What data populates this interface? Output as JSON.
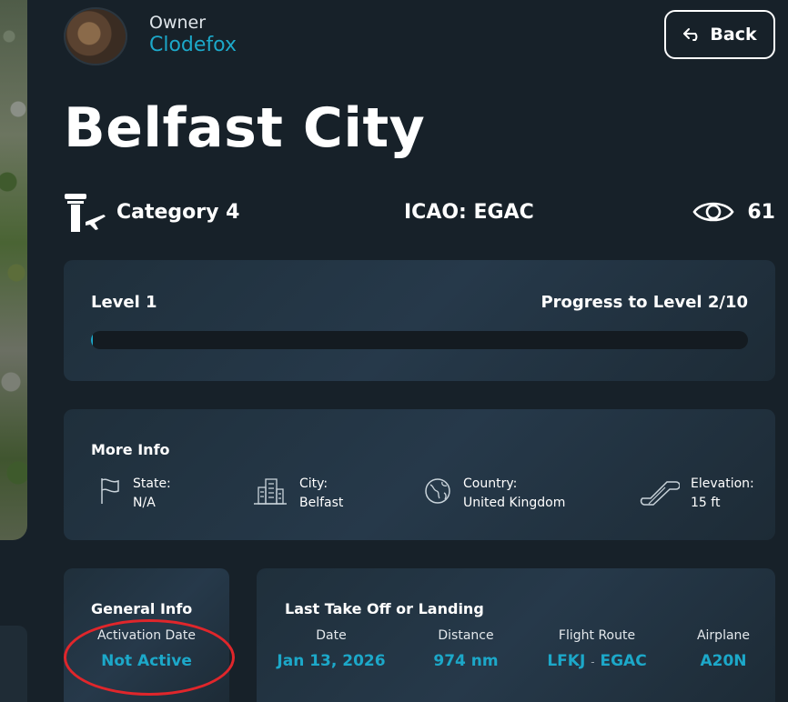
{
  "owner": {
    "label": "Owner",
    "name": "Clodefox"
  },
  "back_button": {
    "label": "Back",
    "icon": "back-arrow-icon"
  },
  "airport": {
    "name": "Belfast City",
    "category": "Category 4",
    "icao": "ICAO: EGAC",
    "views": "61"
  },
  "level": {
    "current": "Level 1",
    "progress_label": "Progress to Level 2/10",
    "progress_fraction": 0.0
  },
  "more_info": {
    "title": "More Info",
    "items": [
      {
        "icon": "flag-icon",
        "label": "State:",
        "value": "N/A"
      },
      {
        "icon": "city-buildings-icon",
        "label": "City:",
        "value": "Belfast"
      },
      {
        "icon": "globe-icon",
        "label": "Country:",
        "value": "United Kingdom"
      },
      {
        "icon": "escalator-icon",
        "label": "Elevation:",
        "value": "15 ft"
      }
    ]
  },
  "general_info": {
    "title": "General Info",
    "activation_label": "Activation Date",
    "activation_value": "Not Active"
  },
  "last_takeoff": {
    "title": "Last Take Off or Landing",
    "columns": [
      {
        "label": "Date",
        "value": "Jan 13, 2026"
      },
      {
        "label": "Distance",
        "value": "974 nm"
      },
      {
        "label": "Flight Route",
        "from": "LFKJ",
        "separator": "-",
        "to": "EGAC"
      },
      {
        "label": "Airplane",
        "value": "A20N"
      }
    ]
  },
  "colors": {
    "accent": "#1ca8c9",
    "background": "#172129",
    "annotation": "#e0262b"
  }
}
